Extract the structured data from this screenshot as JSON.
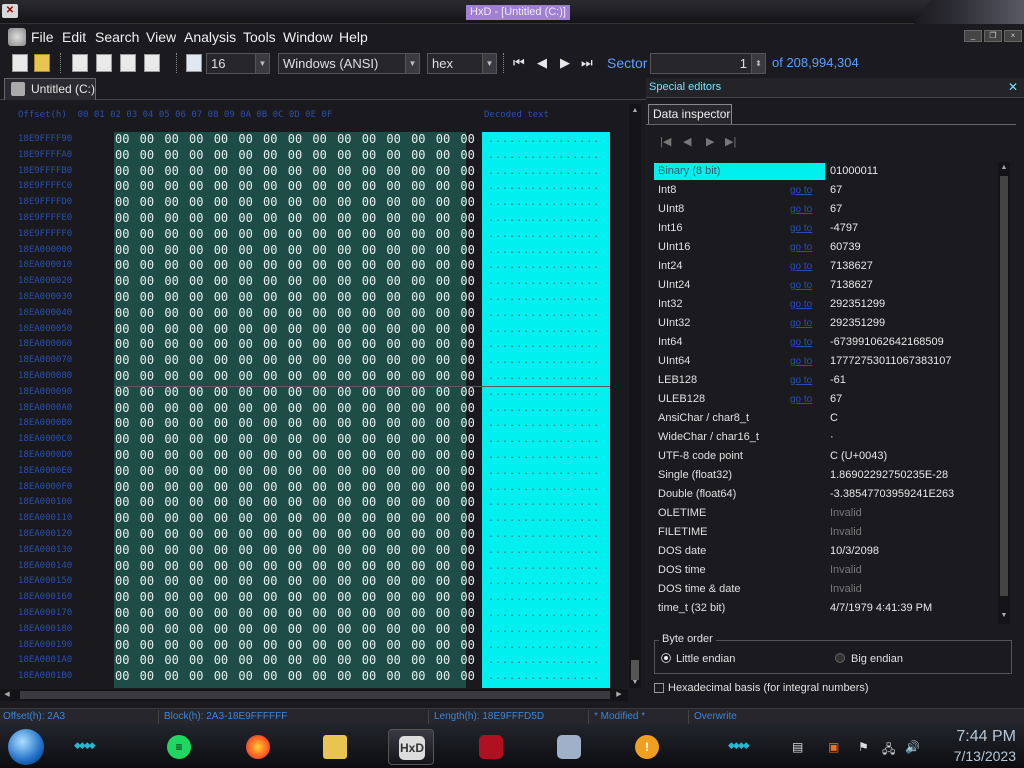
{
  "window": {
    "title": "HxD - [Untitled (C:)]"
  },
  "menu": [
    "File",
    "Edit",
    "Search",
    "View",
    "Analysis",
    "Tools",
    "Window",
    "Help"
  ],
  "toolbar": {
    "bytes_per_row": "16",
    "charset": "Windows (ANSI)",
    "offset_base": "hex",
    "sector_label": "Sector",
    "sector_value": "1",
    "sector_total": "of 208,994,304"
  },
  "document_tab": {
    "label": "Untitled (C:)"
  },
  "hex": {
    "offset_header": "Offset(h)  00 01 02 03 04 05 06 07 08 09 0A 0B 0C 0D 0E 0F",
    "text_header": "Decoded text",
    "offsets": [
      "18E9FFFF90",
      "18E9FFFFA0",
      "18E9FFFFB0",
      "18E9FFFFC0",
      "18E9FFFFD0",
      "18E9FFFFE0",
      "18E9FFFFF0",
      "18EA000000",
      "18EA000010",
      "18EA000020",
      "18EA000030",
      "18EA000040",
      "18EA000050",
      "18EA000060",
      "18EA000070",
      "18EA000080",
      "18EA000090",
      "18EA0000A0",
      "18EA0000B0",
      "18EA0000C0",
      "18EA0000D0",
      "18EA0000E0",
      "18EA0000F0",
      "18EA000100",
      "18EA000110",
      "18EA000120",
      "18EA000130",
      "18EA000140",
      "18EA000150",
      "18EA000160",
      "18EA000170",
      "18EA000180",
      "18EA000190",
      "18EA0001A0",
      "18EA0001B0"
    ],
    "row_bytes": "00 00 00 00 00 00 00 00 00 00 00 00 00 00 00 00",
    "row_text": "................"
  },
  "special_editors": {
    "title": "Special editors",
    "tab": "Data inspector"
  },
  "inspector": [
    {
      "name": "Binary (8 bit)",
      "link": "",
      "value": "01000011",
      "selected": true
    },
    {
      "name": "Int8",
      "link": "go to",
      "value": "67"
    },
    {
      "name": "UInt8",
      "link": "go to",
      "value": "67"
    },
    {
      "name": "Int16",
      "link": "go to",
      "value": "-4797"
    },
    {
      "name": "UInt16",
      "link": "go to",
      "value": "60739"
    },
    {
      "name": "Int24",
      "link": "go to",
      "value": "7138627"
    },
    {
      "name": "UInt24",
      "link": "go to",
      "value": "7138627"
    },
    {
      "name": "Int32",
      "link": "go to",
      "value": "292351299"
    },
    {
      "name": "UInt32",
      "link": "go to",
      "value": "292351299"
    },
    {
      "name": "Int64",
      "link": "go to",
      "value": "-673991062642168509"
    },
    {
      "name": "UInt64",
      "link": "go to",
      "value": "17772753011067383107"
    },
    {
      "name": "LEB128",
      "link": "go to",
      "value": "-61"
    },
    {
      "name": "ULEB128",
      "link": "go to",
      "value": "67"
    },
    {
      "name": "AnsiChar / char8_t",
      "link": "",
      "value": "C"
    },
    {
      "name": "WideChar / char16_t",
      "link": "",
      "value": "·"
    },
    {
      "name": "UTF-8 code point",
      "link": "",
      "value": "C (U+0043)"
    },
    {
      "name": "Single (float32)",
      "link": "",
      "value": "1.86902292750235E-28"
    },
    {
      "name": "Double (float64)",
      "link": "",
      "value": "-3.38547703959241E263"
    },
    {
      "name": "OLETIME",
      "link": "",
      "value": "Invalid",
      "invalid": true
    },
    {
      "name": "FILETIME",
      "link": "",
      "value": "Invalid",
      "invalid": true
    },
    {
      "name": "DOS date",
      "link": "",
      "value": "10/3/2098"
    },
    {
      "name": "DOS time",
      "link": "",
      "value": "Invalid",
      "invalid": true
    },
    {
      "name": "DOS time & date",
      "link": "",
      "value": "Invalid",
      "invalid": true
    },
    {
      "name": "time_t (32 bit)",
      "link": "",
      "value": "4/7/1979 4:41:39 PM"
    }
  ],
  "byte_order": {
    "label": "Byte order",
    "little": "Little endian",
    "big": "Big endian"
  },
  "hex_basis": "Hexadecimal basis (for integral numbers)",
  "status": {
    "offset": "Offset(h): 2A3",
    "block": "Block(h): 2A3-18E9FFFFFF",
    "length": "Length(h): 18E9FFFD5D",
    "modified": "* Modified *",
    "mode": "Overwrite"
  },
  "taskbar": {
    "time": "7:44 PM",
    "date": "7/13/2023",
    "hxd_icon": "HxD"
  },
  "colors": {
    "hex_bg": "#1e4d48",
    "text_bg": "#00f0f0",
    "accent": "#3d86d8",
    "title_highlight": "#a080d0"
  }
}
